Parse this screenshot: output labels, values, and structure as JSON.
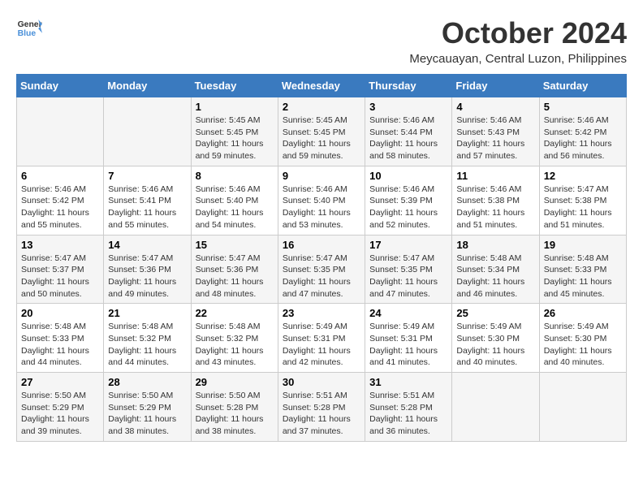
{
  "header": {
    "logo_line1": "General",
    "logo_line2": "Blue",
    "month": "October 2024",
    "location": "Meycauayan, Central Luzon, Philippines"
  },
  "weekdays": [
    "Sunday",
    "Monday",
    "Tuesday",
    "Wednesday",
    "Thursday",
    "Friday",
    "Saturday"
  ],
  "weeks": [
    [
      {
        "day": "",
        "info": ""
      },
      {
        "day": "",
        "info": ""
      },
      {
        "day": "1",
        "info": "Sunrise: 5:45 AM\nSunset: 5:45 PM\nDaylight: 11 hours and 59 minutes."
      },
      {
        "day": "2",
        "info": "Sunrise: 5:45 AM\nSunset: 5:45 PM\nDaylight: 11 hours and 59 minutes."
      },
      {
        "day": "3",
        "info": "Sunrise: 5:46 AM\nSunset: 5:44 PM\nDaylight: 11 hours and 58 minutes."
      },
      {
        "day": "4",
        "info": "Sunrise: 5:46 AM\nSunset: 5:43 PM\nDaylight: 11 hours and 57 minutes."
      },
      {
        "day": "5",
        "info": "Sunrise: 5:46 AM\nSunset: 5:42 PM\nDaylight: 11 hours and 56 minutes."
      }
    ],
    [
      {
        "day": "6",
        "info": "Sunrise: 5:46 AM\nSunset: 5:42 PM\nDaylight: 11 hours and 55 minutes."
      },
      {
        "day": "7",
        "info": "Sunrise: 5:46 AM\nSunset: 5:41 PM\nDaylight: 11 hours and 55 minutes."
      },
      {
        "day": "8",
        "info": "Sunrise: 5:46 AM\nSunset: 5:40 PM\nDaylight: 11 hours and 54 minutes."
      },
      {
        "day": "9",
        "info": "Sunrise: 5:46 AM\nSunset: 5:40 PM\nDaylight: 11 hours and 53 minutes."
      },
      {
        "day": "10",
        "info": "Sunrise: 5:46 AM\nSunset: 5:39 PM\nDaylight: 11 hours and 52 minutes."
      },
      {
        "day": "11",
        "info": "Sunrise: 5:46 AM\nSunset: 5:38 PM\nDaylight: 11 hours and 51 minutes."
      },
      {
        "day": "12",
        "info": "Sunrise: 5:47 AM\nSunset: 5:38 PM\nDaylight: 11 hours and 51 minutes."
      }
    ],
    [
      {
        "day": "13",
        "info": "Sunrise: 5:47 AM\nSunset: 5:37 PM\nDaylight: 11 hours and 50 minutes."
      },
      {
        "day": "14",
        "info": "Sunrise: 5:47 AM\nSunset: 5:36 PM\nDaylight: 11 hours and 49 minutes."
      },
      {
        "day": "15",
        "info": "Sunrise: 5:47 AM\nSunset: 5:36 PM\nDaylight: 11 hours and 48 minutes."
      },
      {
        "day": "16",
        "info": "Sunrise: 5:47 AM\nSunset: 5:35 PM\nDaylight: 11 hours and 47 minutes."
      },
      {
        "day": "17",
        "info": "Sunrise: 5:47 AM\nSunset: 5:35 PM\nDaylight: 11 hours and 47 minutes."
      },
      {
        "day": "18",
        "info": "Sunrise: 5:48 AM\nSunset: 5:34 PM\nDaylight: 11 hours and 46 minutes."
      },
      {
        "day": "19",
        "info": "Sunrise: 5:48 AM\nSunset: 5:33 PM\nDaylight: 11 hours and 45 minutes."
      }
    ],
    [
      {
        "day": "20",
        "info": "Sunrise: 5:48 AM\nSunset: 5:33 PM\nDaylight: 11 hours and 44 minutes."
      },
      {
        "day": "21",
        "info": "Sunrise: 5:48 AM\nSunset: 5:32 PM\nDaylight: 11 hours and 44 minutes."
      },
      {
        "day": "22",
        "info": "Sunrise: 5:48 AM\nSunset: 5:32 PM\nDaylight: 11 hours and 43 minutes."
      },
      {
        "day": "23",
        "info": "Sunrise: 5:49 AM\nSunset: 5:31 PM\nDaylight: 11 hours and 42 minutes."
      },
      {
        "day": "24",
        "info": "Sunrise: 5:49 AM\nSunset: 5:31 PM\nDaylight: 11 hours and 41 minutes."
      },
      {
        "day": "25",
        "info": "Sunrise: 5:49 AM\nSunset: 5:30 PM\nDaylight: 11 hours and 40 minutes."
      },
      {
        "day": "26",
        "info": "Sunrise: 5:49 AM\nSunset: 5:30 PM\nDaylight: 11 hours and 40 minutes."
      }
    ],
    [
      {
        "day": "27",
        "info": "Sunrise: 5:50 AM\nSunset: 5:29 PM\nDaylight: 11 hours and 39 minutes."
      },
      {
        "day": "28",
        "info": "Sunrise: 5:50 AM\nSunset: 5:29 PM\nDaylight: 11 hours and 38 minutes."
      },
      {
        "day": "29",
        "info": "Sunrise: 5:50 AM\nSunset: 5:28 PM\nDaylight: 11 hours and 38 minutes."
      },
      {
        "day": "30",
        "info": "Sunrise: 5:51 AM\nSunset: 5:28 PM\nDaylight: 11 hours and 37 minutes."
      },
      {
        "day": "31",
        "info": "Sunrise: 5:51 AM\nSunset: 5:28 PM\nDaylight: 11 hours and 36 minutes."
      },
      {
        "day": "",
        "info": ""
      },
      {
        "day": "",
        "info": ""
      }
    ]
  ]
}
